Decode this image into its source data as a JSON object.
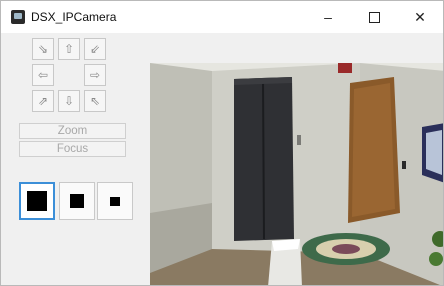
{
  "window": {
    "title": "DSX_IPCamera",
    "minimize_glyph": "–",
    "close_glyph": "✕"
  },
  "ptz": {
    "up_left": "⇘",
    "up": "⇧",
    "up_right": "⇙",
    "left": "⇦",
    "right": "⇨",
    "down_left": "⇗",
    "down": "⇩",
    "down_right": "⇖"
  },
  "controls": {
    "zoom_label": "Zoom",
    "focus_label": "Focus"
  },
  "view_sizes": {
    "selected": "large",
    "options": [
      "large",
      "medium",
      "small"
    ]
  },
  "icons": {
    "app": "camera-app-icon",
    "minimize": "minimize-icon",
    "maximize": "maximize-icon",
    "close": "close-icon"
  },
  "colors": {
    "selected_border": "#3c8fd8",
    "window_bg": "#f0f0f0"
  }
}
